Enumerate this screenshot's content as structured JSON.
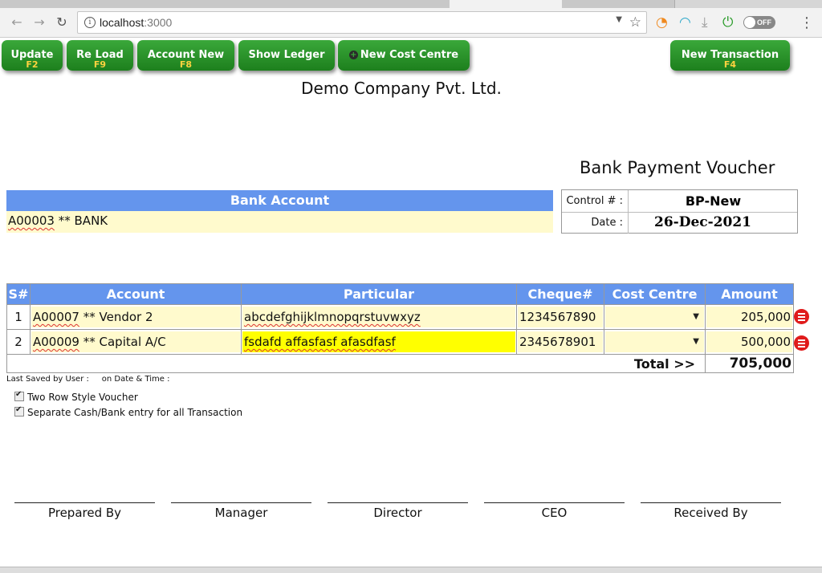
{
  "browser": {
    "url_host": "localhost",
    "url_port": ":3000",
    "extension_toggle_label": "OFF"
  },
  "buttons": [
    {
      "label": "Update",
      "key": "F2"
    },
    {
      "label": "Re Load",
      "key": "F9"
    },
    {
      "label": "Account New",
      "key": "F8"
    },
    {
      "label": "Show Ledger",
      "key": ""
    },
    {
      "label": "New Cost Centre",
      "key": ""
    },
    {
      "label": "New Transaction",
      "key": "F4"
    }
  ],
  "company_name": "Demo Company Pvt. Ltd.",
  "voucher_title": "Bank Payment Voucher",
  "bank": {
    "header": "Bank Account",
    "code": "A00003",
    "name": " ** BANK"
  },
  "control": {
    "control_label": "Control # :",
    "control_value": "BP-New",
    "date_label": "Date :",
    "date_value": "26-Dec-2021"
  },
  "grid": {
    "columns": [
      "S#",
      "Account",
      "Particular",
      "Cheque#",
      "Cost Centre",
      "Amount"
    ],
    "rows": [
      {
        "sn": "1",
        "account_code": "A00007",
        "account_name": " ** Vendor 2",
        "particular": "abcdefghijklmnopqrstuvwxyz",
        "cheque": "1234567890",
        "cost_centre": "",
        "amount": "205,000"
      },
      {
        "sn": "2",
        "account_code": "A00009",
        "account_name": " ** Capital A/C",
        "particular": "fsdafd affasfasf afasdfasf",
        "cheque": "2345678901",
        "cost_centre": "",
        "amount": "500,000"
      }
    ],
    "total_label": "Total >>",
    "total_value": "705,000"
  },
  "last_saved": "Last Saved by User :     on Date & Time :",
  "options": [
    {
      "label": "Two Row Style Voucher",
      "checked": true
    },
    {
      "label": "Separate Cash/Bank entry for all Transaction",
      "checked": true
    }
  ],
  "signatures": [
    "Prepared By",
    "Manager",
    "Director",
    "CEO",
    "Received By"
  ]
}
